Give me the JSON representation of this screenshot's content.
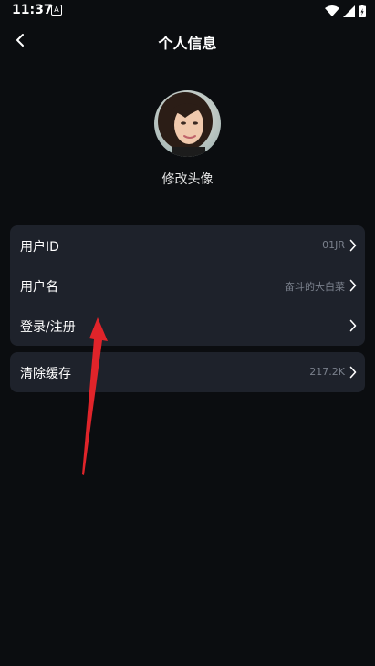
{
  "status_bar": {
    "time": "11:37",
    "app_icon_glyph": "A",
    "icons": [
      "wifi-icon",
      "cellular-signal-icon",
      "battery-icon"
    ]
  },
  "header": {
    "title": "个人信息",
    "back_icon": "back-arrow-icon"
  },
  "profile": {
    "avatar_caption": "修改头像"
  },
  "settings_group": [
    {
      "label": "用户ID",
      "value": "01JR"
    },
    {
      "label": "用户名",
      "value": "奋斗的大白菜"
    },
    {
      "label": "登录/注册",
      "value": ""
    }
  ],
  "cache": {
    "label": "清除缓存",
    "value": "217.2K"
  },
  "colors": {
    "background": "#0b0d10",
    "card": "#1e222b",
    "secondary_text": "#7a808c",
    "annotation_arrow": "#e0242a"
  }
}
